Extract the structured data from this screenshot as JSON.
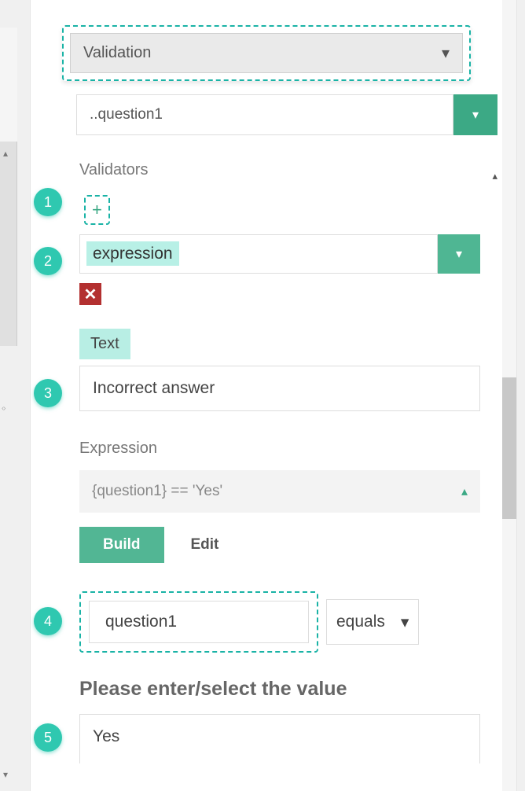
{
  "header": {
    "title": "Validation"
  },
  "question_dropdown": {
    "value": "..question1"
  },
  "validators_label": "Validators",
  "validator_type": {
    "value": "expression"
  },
  "text_section": {
    "label": "Text",
    "value": "Incorrect answer"
  },
  "expression_section": {
    "label": "Expression",
    "code": "{question1} == 'Yes'",
    "build_label": "Build",
    "edit_label": "Edit"
  },
  "condition": {
    "field": "question1",
    "operator": "equals"
  },
  "value_section": {
    "label": "Please enter/select the value",
    "value": "Yes"
  },
  "badges": {
    "b1": "1",
    "b2": "2",
    "b3": "3",
    "b4": "4",
    "b5": "5"
  }
}
